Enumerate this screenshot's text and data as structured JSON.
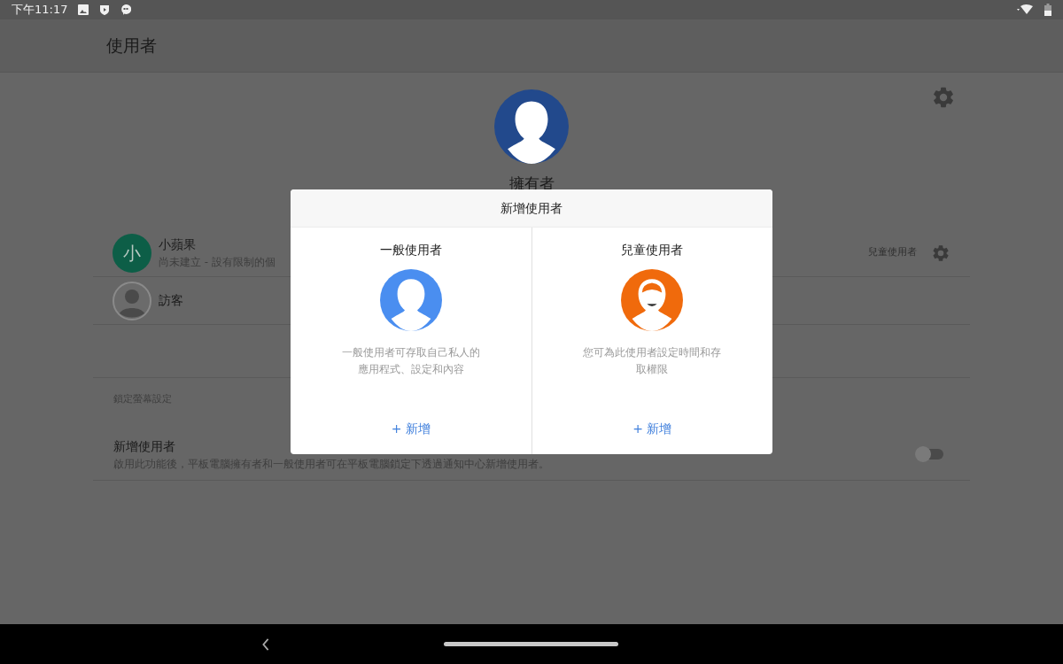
{
  "status_bar": {
    "time": "下午11:17"
  },
  "app_bar": {
    "title": "使用者"
  },
  "owner": {
    "name": "擁有者"
  },
  "users": [
    {
      "kind": "profile",
      "initial": "小",
      "name": "小蘋果",
      "subtitle": "尚未建立 - 設有限制的個",
      "tag": "兒童使用者",
      "color": "#0d5e47"
    },
    {
      "kind": "guest",
      "name": "訪客"
    }
  ],
  "lock_screen": {
    "header": "鎖定螢幕設定",
    "title": "新增使用者",
    "description": "啟用此功能後，平板電腦擁有者和一般使用者可在平板電腦鎖定下透過通知中心新增使用者。",
    "on": false
  },
  "dialog": {
    "title": "新增使用者",
    "options": [
      {
        "kind": "regular",
        "title": "一般使用者",
        "description": "一般使用者可存取自己私人的應用程式、設定和內容",
        "action": "+ 新增"
      },
      {
        "kind": "child",
        "title": "兒童使用者",
        "description": "您可為此使用者設定時間和存取權限",
        "action": "+ 新增"
      }
    ]
  }
}
